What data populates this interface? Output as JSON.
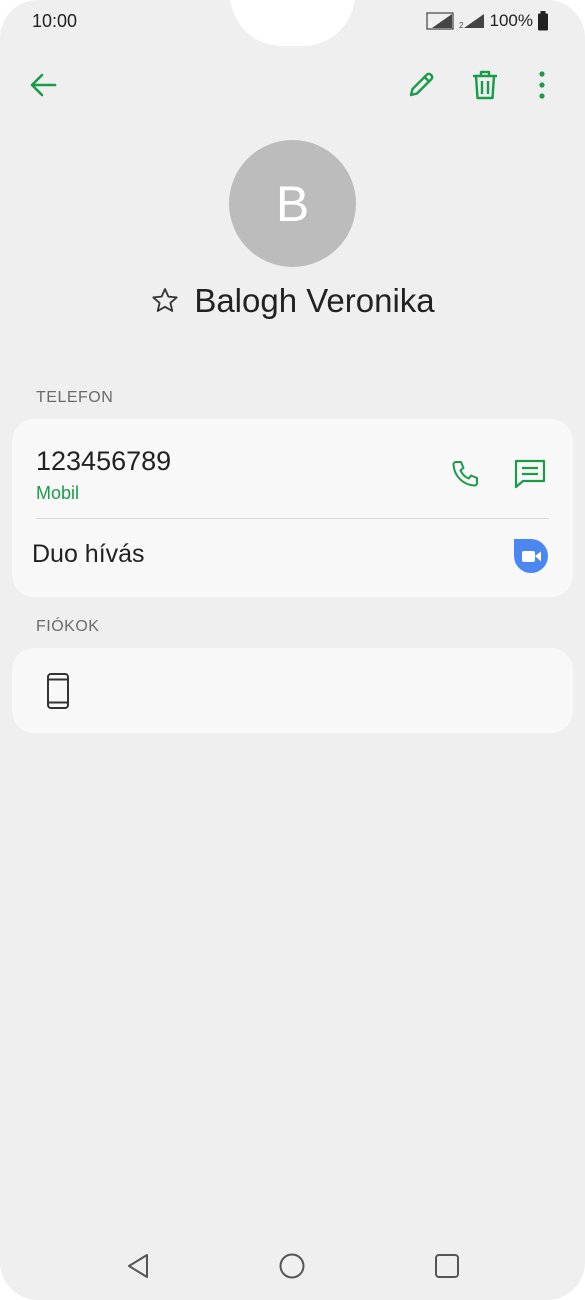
{
  "status_bar": {
    "time": "10:00",
    "battery": "100%"
  },
  "header": {
    "back_icon": "arrow-left-icon",
    "edit_icon": "pencil-icon",
    "delete_icon": "trash-icon",
    "more_icon": "more-vertical-icon",
    "accent_color": "#1a9b4a"
  },
  "contact": {
    "avatar_letter": "B",
    "name": "Balogh Veronika",
    "favorite_icon": "star-outline-icon"
  },
  "phone_section": {
    "label": "TELEFON",
    "number": "123456789",
    "type": "Mobil",
    "duo_label": "Duo hívás"
  },
  "accounts_section": {
    "label": "FIÓKOK",
    "device_icon": "phone-device-icon"
  },
  "nav": {
    "back": "triangle-back-icon",
    "home": "circle-home-icon",
    "recents": "square-recents-icon"
  }
}
